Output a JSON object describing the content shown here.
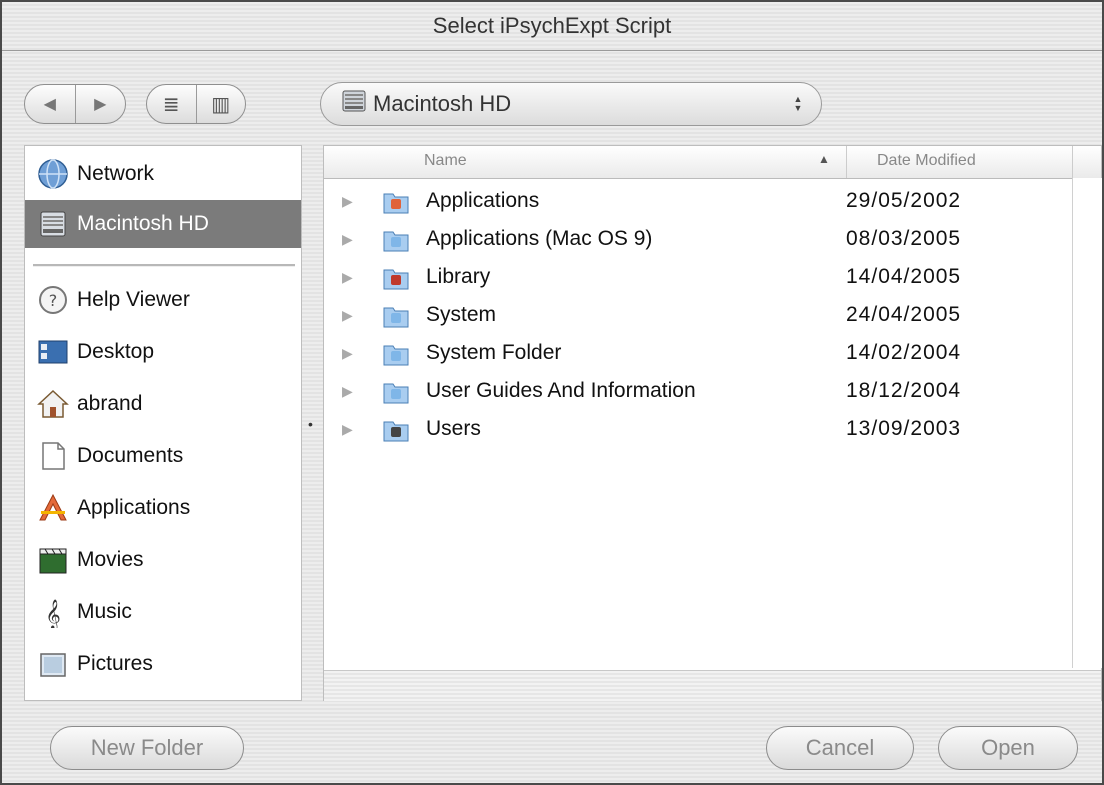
{
  "window": {
    "title": "Select iPsychExpt Script"
  },
  "toolbar": {
    "back_glyph": "◀",
    "forward_glyph": "▶",
    "list_view_glyph": "≣",
    "column_view_glyph": "▥",
    "location": "Macintosh HD"
  },
  "sidebar": {
    "devices": [
      {
        "label": "Network",
        "icon": "network-globe-icon"
      },
      {
        "label": "Macintosh HD",
        "icon": "hard-disk-icon",
        "selected": true
      }
    ],
    "places": [
      {
        "label": "Help Viewer",
        "icon": "help-viewer-icon"
      },
      {
        "label": "Desktop",
        "icon": "desktop-icon"
      },
      {
        "label": "abrand",
        "icon": "home-icon"
      },
      {
        "label": "Documents",
        "icon": "documents-icon"
      },
      {
        "label": "Applications",
        "icon": "applications-icon"
      },
      {
        "label": "Movies",
        "icon": "movies-icon"
      },
      {
        "label": "Music",
        "icon": "music-icon"
      },
      {
        "label": "Pictures",
        "icon": "pictures-icon"
      }
    ]
  },
  "browser": {
    "columns": {
      "name": "Name",
      "date": "Date Modified"
    },
    "rows": [
      {
        "name": "Applications",
        "date": "29/05/2002",
        "icon": "applications-folder-icon",
        "color": "#e0633a"
      },
      {
        "name": "Applications (Mac OS 9)",
        "date": "08/03/2005",
        "icon": "folder-icon",
        "color": "#7fb6e8"
      },
      {
        "name": "Library",
        "date": "14/04/2005",
        "icon": "library-folder-icon",
        "color": "#c0392b"
      },
      {
        "name": "System",
        "date": "24/04/2005",
        "icon": "system-folder-icon",
        "color": "#7fb6e8"
      },
      {
        "name": "System Folder",
        "date": "14/02/2004",
        "icon": "system-folder-icon",
        "color": "#7fb6e8"
      },
      {
        "name": "User Guides And Information",
        "date": "18/12/2004",
        "icon": "folder-icon",
        "color": "#7fb6e8"
      },
      {
        "name": "Users",
        "date": "13/09/2003",
        "icon": "users-folder-icon",
        "color": "#444444"
      }
    ]
  },
  "buttons": {
    "new_folder": "New Folder",
    "cancel": "Cancel",
    "open": "Open"
  }
}
